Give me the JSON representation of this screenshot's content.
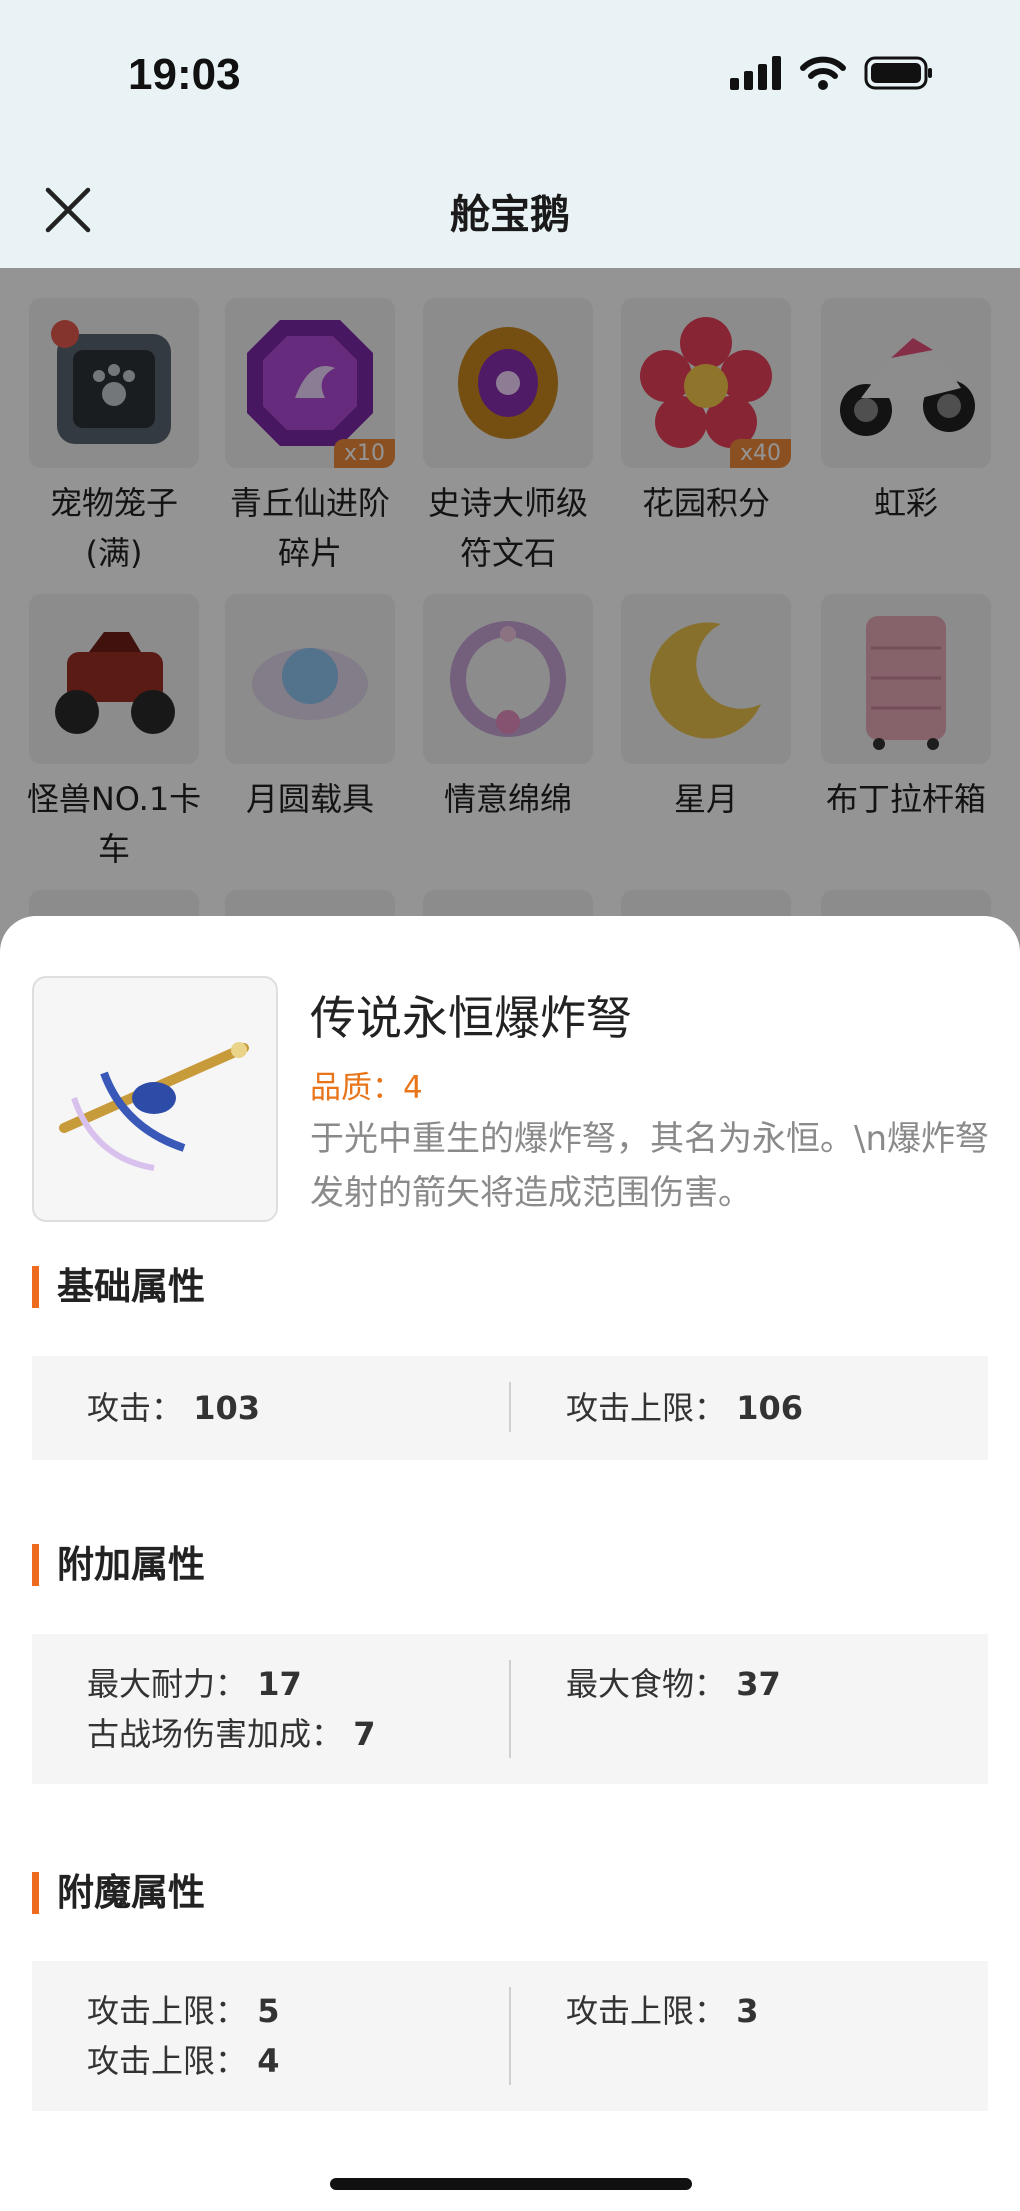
{
  "status": {
    "time": "19:03"
  },
  "nav": {
    "title": "舱宝鹅"
  },
  "grid_items": [
    {
      "label": "宠物笼子\n(满)",
      "badge": "",
      "icon": "pet-cage-icon"
    },
    {
      "label": "青丘仙进阶\n碎片",
      "badge": "x10",
      "icon": "purple-gem-icon"
    },
    {
      "label": "史诗大师级\n符文石",
      "badge": "",
      "icon": "rune-stone-icon"
    },
    {
      "label": "花园积分",
      "badge": "x40",
      "icon": "flower-icon"
    },
    {
      "label": "虹彩",
      "badge": "",
      "icon": "motorcycle-icon"
    },
    {
      "label": "怪兽NO.1卡\n车",
      "badge": "",
      "icon": "monster-truck-icon"
    },
    {
      "label": "月圆载具",
      "badge": "",
      "icon": "moon-orb-icon"
    },
    {
      "label": "情意绵绵",
      "badge": "",
      "icon": "wreath-icon"
    },
    {
      "label": "星月",
      "badge": "",
      "icon": "crescent-moon-icon"
    },
    {
      "label": "布丁拉杆箱",
      "badge": "",
      "icon": "suitcase-icon"
    }
  ],
  "detail": {
    "name": "传说永恒爆炸弩",
    "quality": "品质：4",
    "description": "于光中重生的爆炸弩，其名为永恒。\\n爆炸弩发射的箭矢将造成范围伤害。",
    "sections": [
      {
        "title": "基础属性",
        "left": [
          {
            "label": "攻击：",
            "value": "103"
          }
        ],
        "right": [
          {
            "label": "攻击上限：",
            "value": "106"
          }
        ]
      },
      {
        "title": "附加属性",
        "left": [
          {
            "label": "最大耐力：",
            "value": "17"
          },
          {
            "label": "古战场伤害加成：",
            "value": "7"
          }
        ],
        "right": [
          {
            "label": "最大食物：",
            "value": "37"
          }
        ]
      },
      {
        "title": "附魔属性",
        "left": [
          {
            "label": "攻击上限：",
            "value": "5"
          },
          {
            "label": "攻击上限：",
            "value": "4"
          }
        ],
        "right": [
          {
            "label": "攻击上限：",
            "value": "3"
          }
        ]
      }
    ]
  },
  "colors": {
    "accent": "#ee6a1e",
    "quality": "#e8751a",
    "badge": "#f08a3c"
  }
}
